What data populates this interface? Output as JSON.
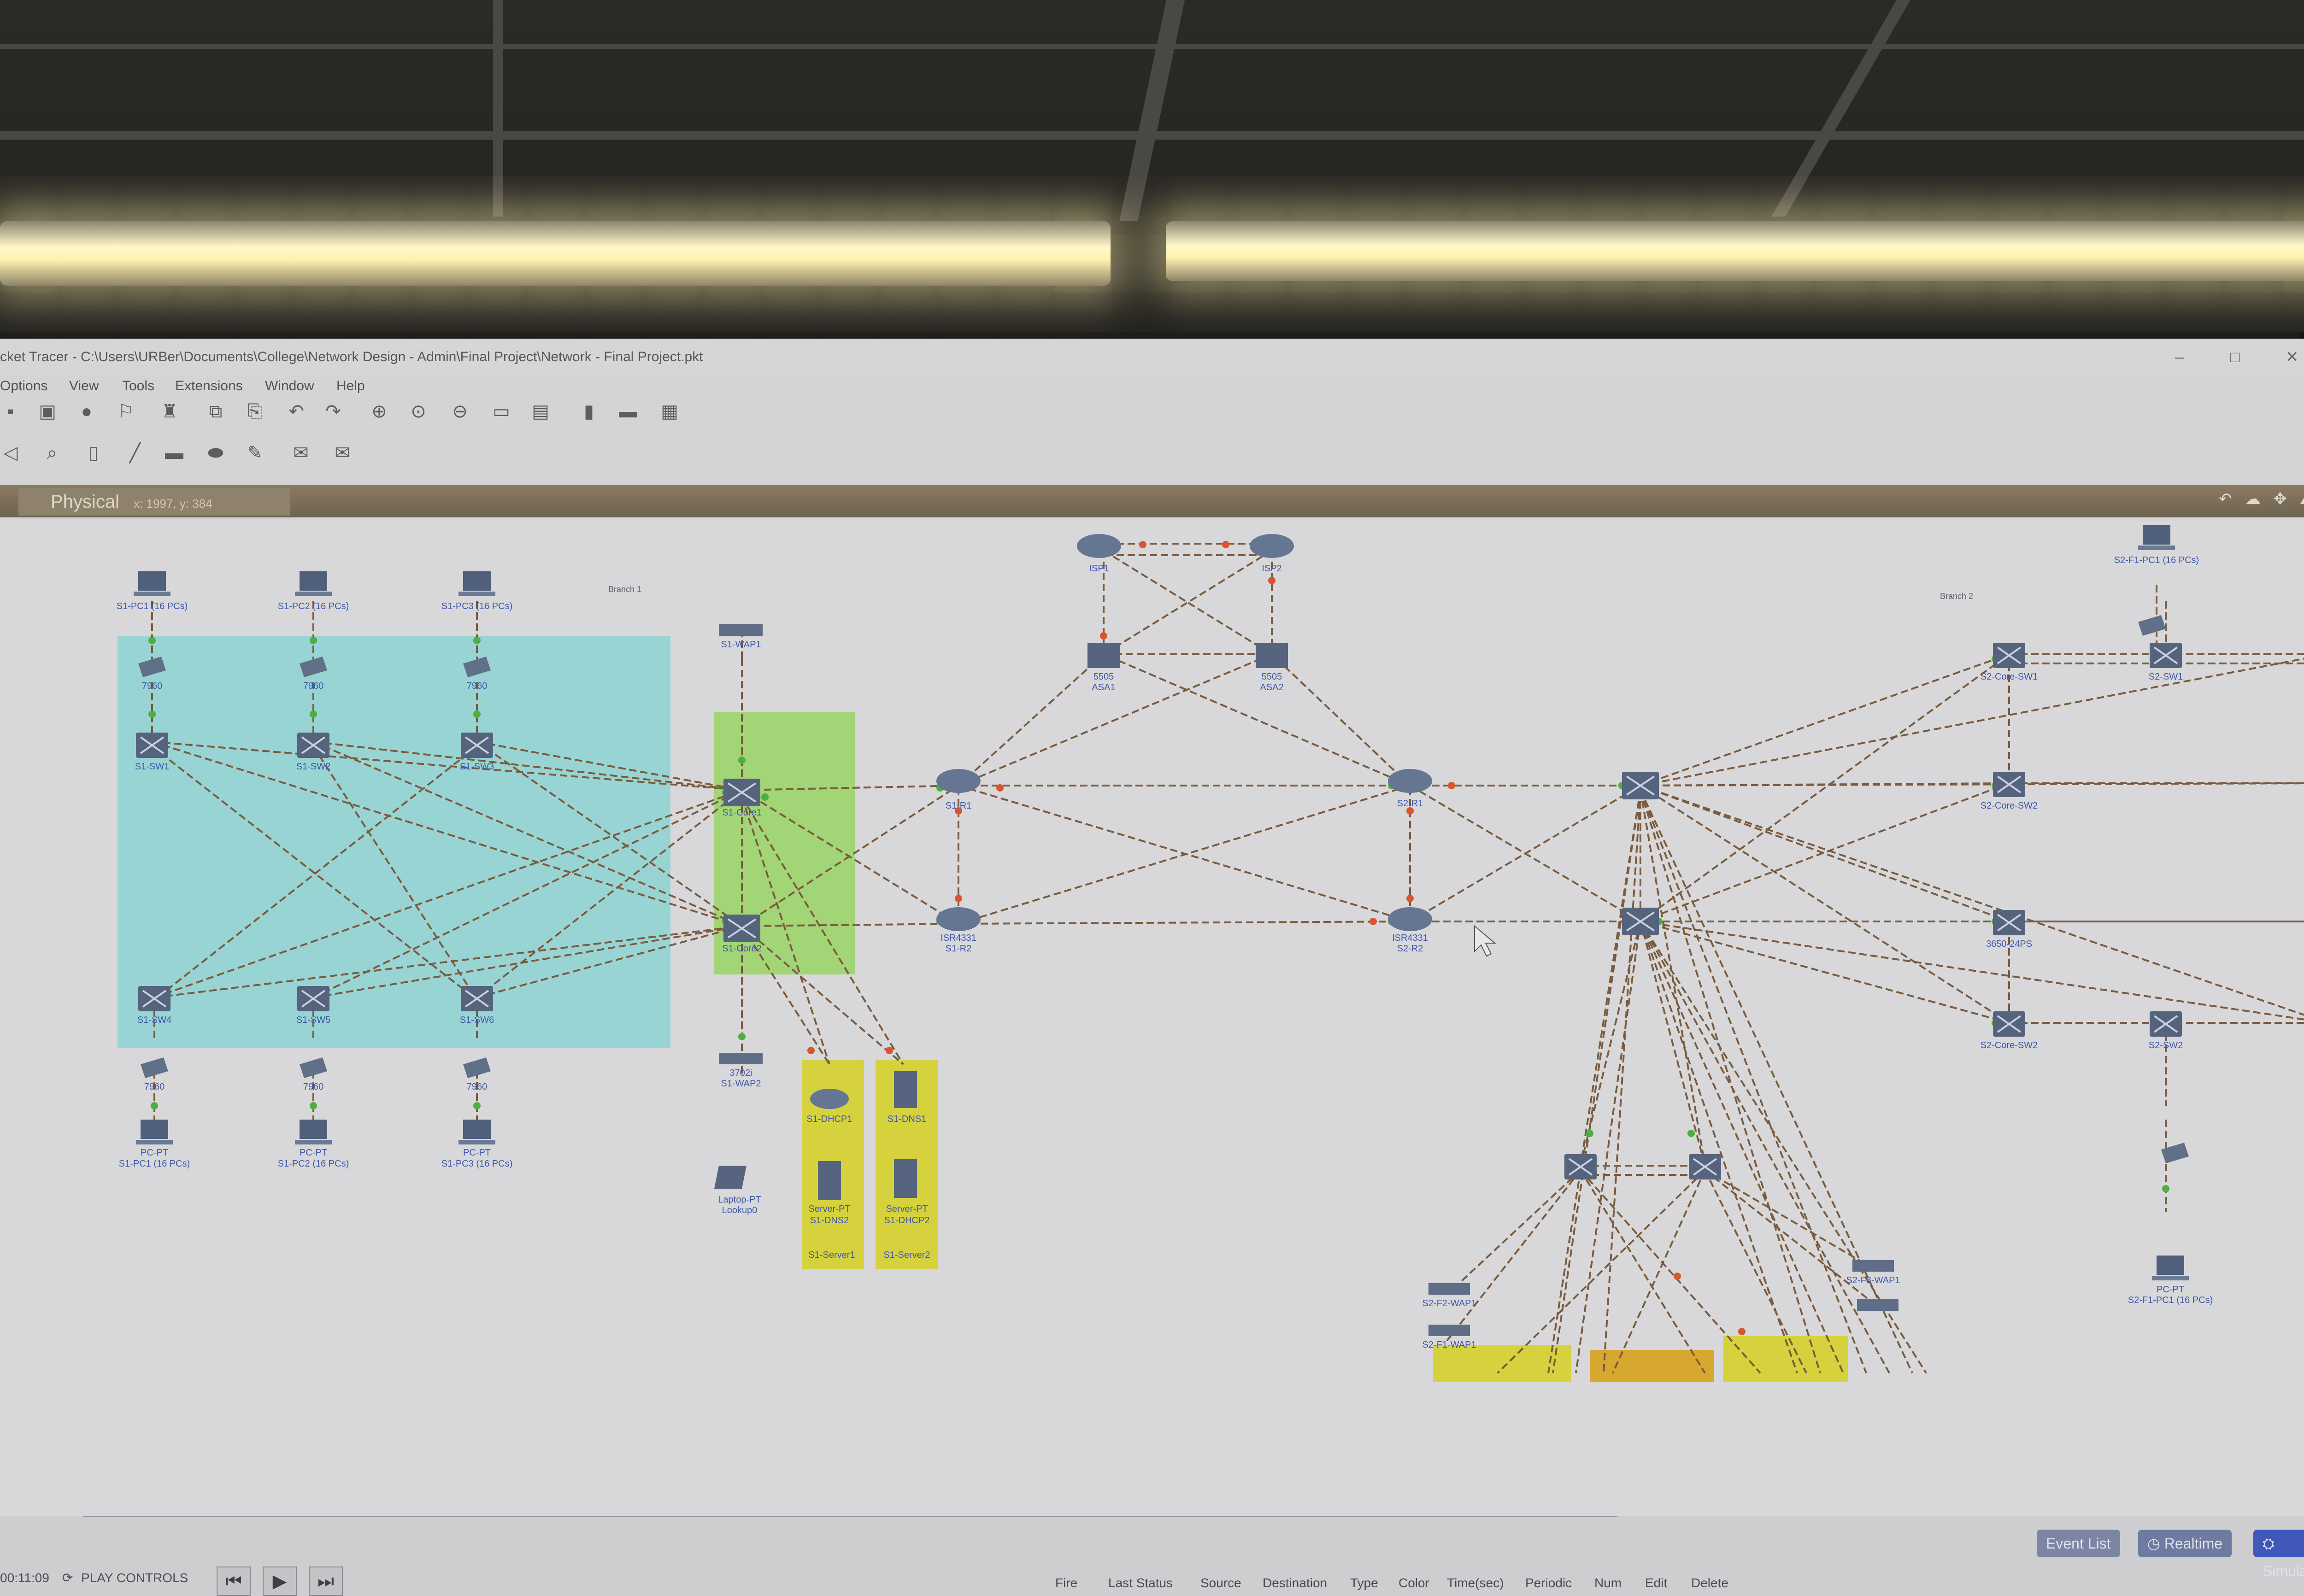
{
  "window": {
    "title": "cket Tracer - C:\\Users\\URBer\\Documents\\College\\Network Design - Admin\\Final Project\\Network - Final Project.pkt"
  },
  "menu": [
    "Options",
    "View",
    "Tools",
    "Extensions",
    "Window",
    "Help"
  ],
  "workspace": {
    "tab": "Physical",
    "coords": "x: 1997, y: 384"
  },
  "areas": {
    "branch1": "Branch 1",
    "branch2": "Branch 2"
  },
  "devices": {
    "pc1": "S1-PC1 (16 PCs)",
    "pc2": "S1-PC2 (16 PCs)",
    "pc3": "S1-PC3 (16 PCs)",
    "phone": "7960",
    "sw_dist1": "S1-SW1",
    "sw_dist2": "S1-SW2",
    "sw_dist3": "S1-SW3",
    "sw_acc1": "S1-SW4",
    "sw_acc2": "S1-SW5",
    "sw_acc3": "S1-SW6",
    "core_model": "3650-24PS",
    "s1_core1": "S1-Core1",
    "s1_core2": "S1-Core2",
    "wap1": "S1-WAP1",
    "wap2": "S1-WAP2",
    "wap_model": "3702i",
    "router_model": "ISR4331",
    "s1_r1": "S1-R1",
    "s1_r2": "S1-R2",
    "s2_r1": "S2-R1",
    "s2_r2": "S2-R2",
    "isp1": "ISP1",
    "isp2": "ISP2",
    "asa1": "ASA1",
    "asa2": "ASA2",
    "asa_model": "5505",
    "server_dhcp1": "S1-DHCP1",
    "server_dns1": "S1-DNS1",
    "server_dns2": "S1-DNS2",
    "server_dhcp2": "S1-DHCP2",
    "server_model": "Server-PT",
    "server_box1": "S1-Server1",
    "server_box2": "S1-Server2",
    "laptop": "Laptop-PT",
    "laptop_name": "Lookup0",
    "s2_core1": "S2-Core-SW1",
    "s2_core2": "S2-Core-SW2",
    "s2_dist1": "S2-SW1",
    "s2_dist2": "S2-SW2",
    "s2_wap1": "S2-F2-WAP1",
    "s2_wap2": "S2-F3-WAP1",
    "s2_wap3": "S2-F1-WAP1",
    "s2_pc": "S2-F1-PC1 (16 PCs)",
    "pc_model": "PC-PT"
  },
  "bottom": {
    "time": "00:11:09",
    "play_controls": "PLAY CONTROLS",
    "event_list": "Event List",
    "realtime": "Realtime",
    "simulation": "Simulation",
    "columns": [
      "Fire",
      "Last Status",
      "Source",
      "Destination",
      "Type",
      "Color",
      "Time(sec)",
      "Periodic",
      "Num",
      "Edit",
      "Delete"
    ]
  },
  "colors": {
    "branch1_area": "#8ed3d2",
    "server_area": "#9bd56a",
    "server_box": "#d6d23e",
    "link": "#7a5b3e",
    "link_up": "#4caf3f",
    "link_down": "#d9552f",
    "workbar": "#7b6e58"
  }
}
